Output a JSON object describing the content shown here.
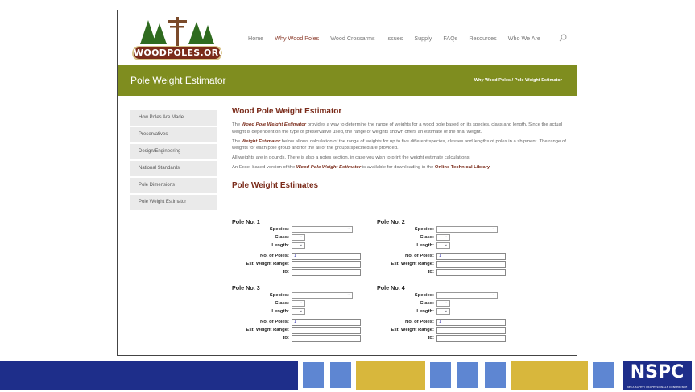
{
  "logo": {
    "text": "WOODPOLES.ORG"
  },
  "nav": {
    "items": [
      "Home",
      "Why Wood Poles",
      "Wood Crossarms",
      "Issues",
      "Supply",
      "FAQs",
      "Resources",
      "Who We Are"
    ],
    "active_index": 1
  },
  "titlebar": {
    "title": "Pole Weight Estimator",
    "breadcrumb_parent": "Why Wood Poles",
    "breadcrumb_sep": "/",
    "breadcrumb_current": "Pole Weight Estimator"
  },
  "sidebar": {
    "items": [
      "How Poles Are Made",
      "Preservatives",
      "Design/Engineering",
      "National Standards",
      "Pole Dimensions",
      "Pole Weight Estimator"
    ]
  },
  "content": {
    "heading": "Wood Pole Weight Estimator",
    "p1_pre": "The ",
    "p1_bold": "Wood Pole Weight Estimator",
    "p1_post": " provides a way to determine the range of weights for a wood pole based on its species, class and length. Since the actual weight is dependent on the type of preservative used, the range of weights shown offers an estimate of the final weight.",
    "p2_pre": "The ",
    "p2_bold": "Weight Estimator",
    "p2_post": " below allows calculation of the range of weights for up to five different species, classes and lengths of poles in a shipment. The range of weights for each pole group and for the all of the groups specified are provided.",
    "p3": "All weights are in pounds. There is also a notes section, in case you wish to print the weight estimate calculations.",
    "p4_pre": "An Excel-based version of the ",
    "p4_bold": "Wood Pole Weight Estimator",
    "p4_mid": " is available for downloading in the ",
    "p4_link": "Online Technical Library",
    "estimates_heading": "Pole Weight Estimates"
  },
  "form": {
    "labels": {
      "species": "Species:",
      "class": "Class:",
      "length": "Length:",
      "num_poles": "No. of Poles:",
      "est_range": "Est. Weight Range:",
      "to": "to:"
    },
    "poles": [
      {
        "title": "Pole No. 1",
        "num_poles": "1"
      },
      {
        "title": "Pole No. 2",
        "num_poles": "1"
      },
      {
        "title": "Pole No. 3",
        "num_poles": "1"
      },
      {
        "title": "Pole No. 4",
        "num_poles": "1"
      }
    ]
  },
  "footer": {
    "brand": "NSPC",
    "brand_sub": "NECA SAFETY PROFESSIONALS CONFERENCE"
  },
  "colors": {
    "brand_brown": "#7a2b1a",
    "titlebar_green": "#7f8d1f",
    "footer_navy": "#1e2e8a",
    "footer_gold": "#d8b73c",
    "footer_blue": "#5e86d2"
  }
}
